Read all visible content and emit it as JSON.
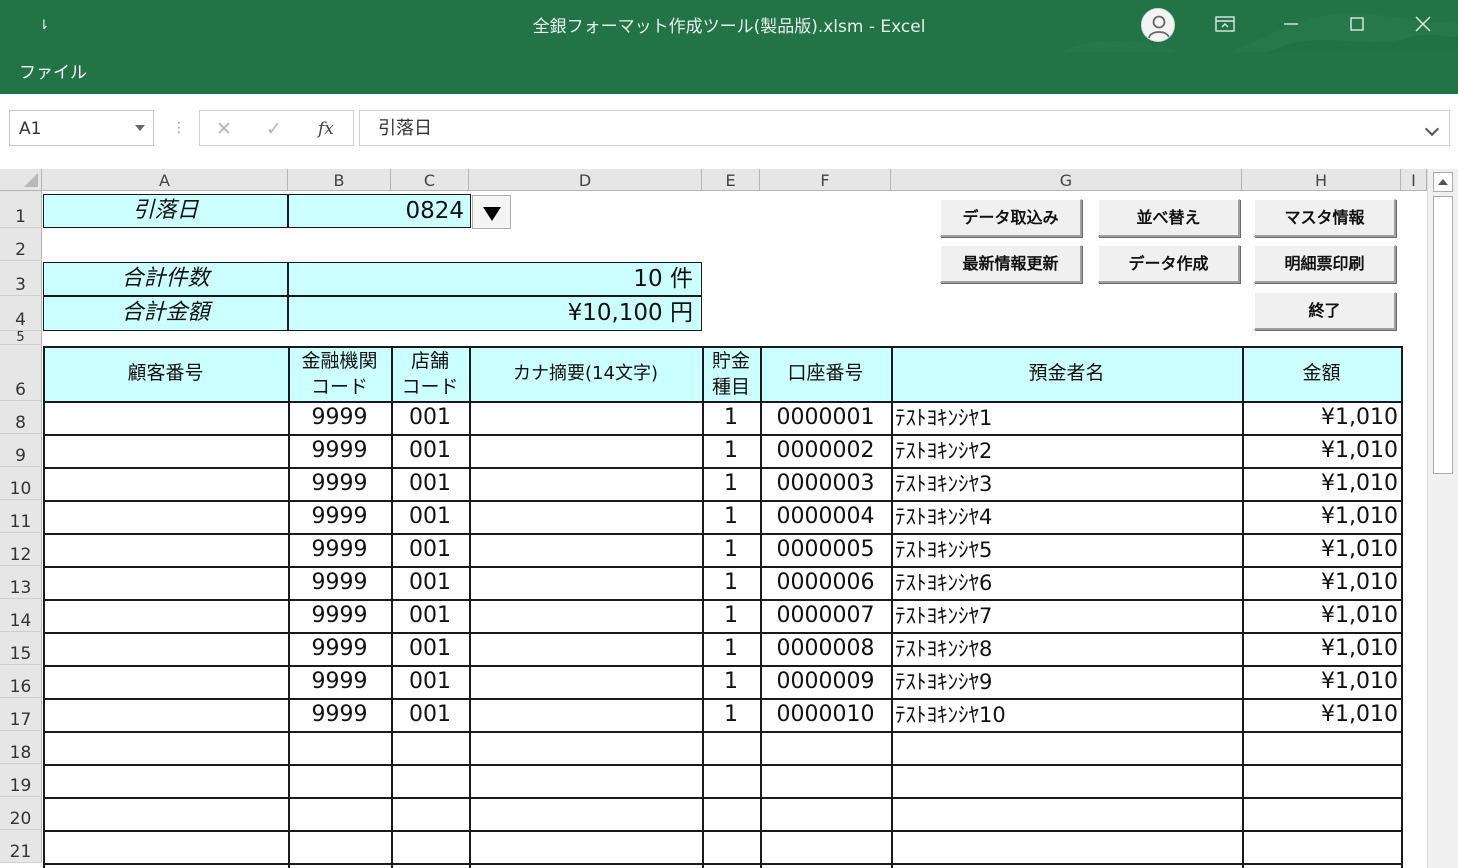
{
  "window": {
    "title": "全銀フォーマット作成ツール(製品版).xlsm  -  Excel",
    "qat_glyph": "⇂",
    "file_tab": "ファイル"
  },
  "formula_bar": {
    "name_box": "A1",
    "cancel_glyph": "✕",
    "enter_glyph": "✓",
    "fx_label": "fx",
    "formula": "引落日",
    "separator": "⋮"
  },
  "columns": [
    "A",
    "B",
    "C",
    "D",
    "E",
    "F",
    "G",
    "H",
    "I"
  ],
  "rows": [
    "1",
    "2",
    "3",
    "4",
    "5",
    "6",
    "8",
    "9",
    "10",
    "11",
    "12",
    "13",
    "14",
    "15",
    "16",
    "17",
    "18",
    "19",
    "20",
    "21"
  ],
  "summary": {
    "debit_date_label": "引落日",
    "debit_date_value": "0824",
    "total_count_label": "合計件数",
    "total_count_value": "10 件",
    "total_amount_label": "合計金額",
    "total_amount_value": "¥10,100 円"
  },
  "buttons": {
    "import": "データ取込み",
    "sort": "並べ替え",
    "master": "マスタ情報",
    "refresh": "最新情報更新",
    "create": "データ作成",
    "print": "明細票印刷",
    "exit": "終了"
  },
  "table": {
    "headers": {
      "customer_no": "顧客番号",
      "bank_code_1": "金融機関",
      "bank_code_2": "コード",
      "branch_code_1": "店舗",
      "branch_code_2": "コード",
      "kana_memo": "カナ摘要(14文字)",
      "deposit_type_1": "貯金",
      "deposit_type_2": "種目",
      "account_no": "口座番号",
      "holder": "預金者名",
      "amount": "金額"
    },
    "rows": [
      {
        "customer": "",
        "bank": "9999",
        "branch": "001",
        "memo": "",
        "type": "1",
        "account": "0000001",
        "holder": "ﾃｽﾄﾖｷﾝｼﾔ1",
        "amount": "¥1,010"
      },
      {
        "customer": "",
        "bank": "9999",
        "branch": "001",
        "memo": "",
        "type": "1",
        "account": "0000002",
        "holder": "ﾃｽﾄﾖｷﾝｼﾔ2",
        "amount": "¥1,010"
      },
      {
        "customer": "",
        "bank": "9999",
        "branch": "001",
        "memo": "",
        "type": "1",
        "account": "0000003",
        "holder": "ﾃｽﾄﾖｷﾝｼﾔ3",
        "amount": "¥1,010"
      },
      {
        "customer": "",
        "bank": "9999",
        "branch": "001",
        "memo": "",
        "type": "1",
        "account": "0000004",
        "holder": "ﾃｽﾄﾖｷﾝｼﾔ4",
        "amount": "¥1,010"
      },
      {
        "customer": "",
        "bank": "9999",
        "branch": "001",
        "memo": "",
        "type": "1",
        "account": "0000005",
        "holder": "ﾃｽﾄﾖｷﾝｼﾔ5",
        "amount": "¥1,010"
      },
      {
        "customer": "",
        "bank": "9999",
        "branch": "001",
        "memo": "",
        "type": "1",
        "account": "0000006",
        "holder": "ﾃｽﾄﾖｷﾝｼﾔ6",
        "amount": "¥1,010"
      },
      {
        "customer": "",
        "bank": "9999",
        "branch": "001",
        "memo": "",
        "type": "1",
        "account": "0000007",
        "holder": "ﾃｽﾄﾖｷﾝｼﾔ7",
        "amount": "¥1,010"
      },
      {
        "customer": "",
        "bank": "9999",
        "branch": "001",
        "memo": "",
        "type": "1",
        "account": "0000008",
        "holder": "ﾃｽﾄﾖｷﾝｼﾔ8",
        "amount": "¥1,010"
      },
      {
        "customer": "",
        "bank": "9999",
        "branch": "001",
        "memo": "",
        "type": "1",
        "account": "0000009",
        "holder": "ﾃｽﾄﾖｷﾝｼﾔ9",
        "amount": "¥1,010"
      },
      {
        "customer": "",
        "bank": "9999",
        "branch": "001",
        "memo": "",
        "type": "1",
        "account": "0000010",
        "holder": "ﾃｽﾄﾖｷﾝｼﾔ10",
        "amount": "¥1,010"
      }
    ]
  },
  "colors": {
    "excel_green": "#227447",
    "cell_cyan": "#ccffff"
  }
}
